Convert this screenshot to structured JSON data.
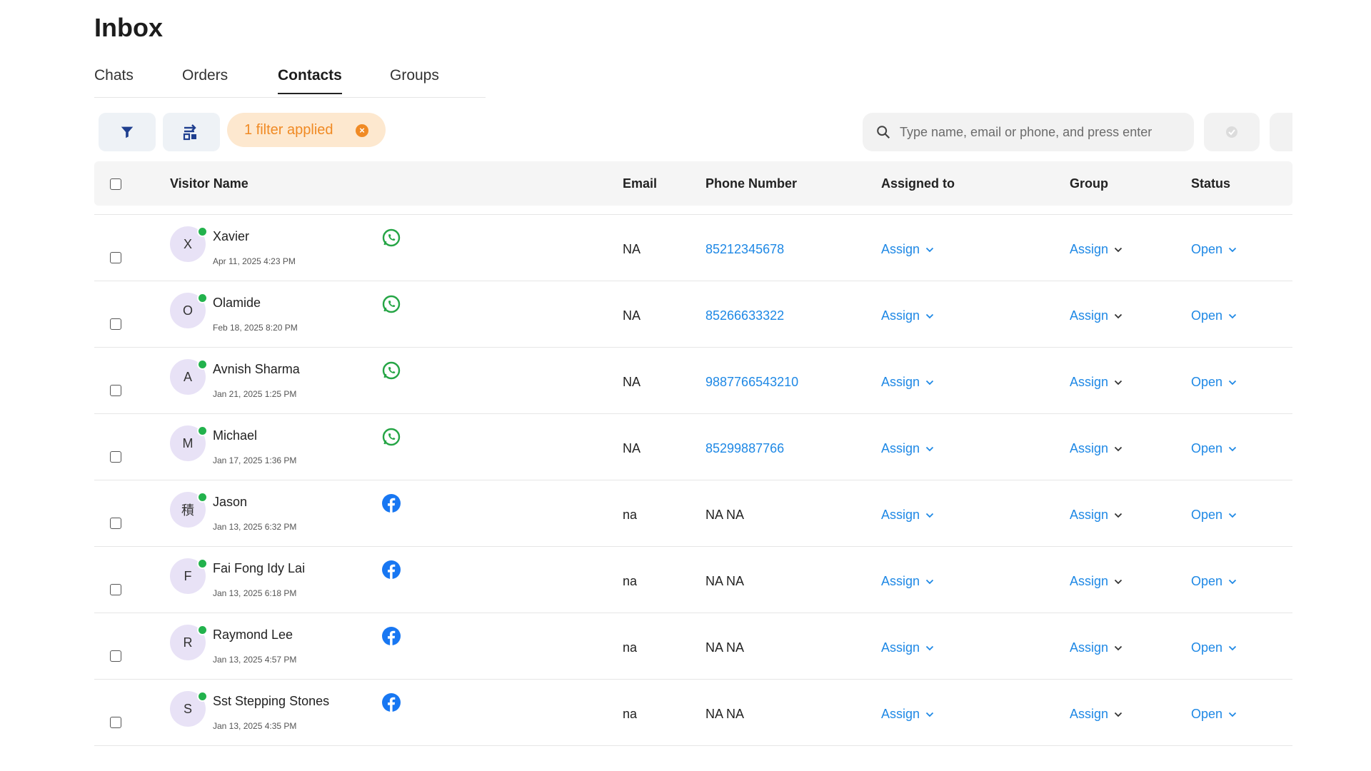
{
  "page_title": "Inbox",
  "tabs": [
    {
      "label": "Chats",
      "active": false
    },
    {
      "label": "Orders",
      "active": false
    },
    {
      "label": "Contacts",
      "active": true
    },
    {
      "label": "Groups",
      "active": false
    }
  ],
  "toolbar": {
    "filter_icon": "filter-icon",
    "sort_icon": "sort-icon",
    "filter_chip_label": "1 filter applied",
    "search_placeholder": "Type name, email or phone, and press enter"
  },
  "colors": {
    "accent_blue": "#1e88e5",
    "chip_orange": "#f08a24",
    "chip_bg": "#fde8cf",
    "online_green": "#22b24c",
    "whatsapp_green": "#25a545",
    "facebook_blue": "#1877f2"
  },
  "table": {
    "headers": {
      "visitor_name": "Visitor Name",
      "email": "Email",
      "phone": "Phone Number",
      "assigned_to": "Assigned to",
      "group": "Group",
      "status": "Status"
    },
    "rows": [
      {
        "initial": "X",
        "name": "Xavier",
        "date": "Apr 11, 2025 4:23 PM",
        "channel": "whatsapp",
        "email": "NA",
        "phone": "85212345678",
        "phone_link": true,
        "assigned": "Assign",
        "group": "Assign",
        "status": "Open"
      },
      {
        "initial": "O",
        "name": "Olamide",
        "date": "Feb 18, 2025 8:20 PM",
        "channel": "whatsapp",
        "email": "NA",
        "phone": "85266633322",
        "phone_link": true,
        "assigned": "Assign",
        "group": "Assign",
        "status": "Open"
      },
      {
        "initial": "A",
        "name": "Avnish Sharma",
        "date": "Jan 21, 2025 1:25 PM",
        "channel": "whatsapp",
        "email": "NA",
        "phone": "9887766543210",
        "phone_link": true,
        "assigned": "Assign",
        "group": "Assign",
        "status": "Open"
      },
      {
        "initial": "M",
        "name": "Michael",
        "date": "Jan 17, 2025 1:36 PM",
        "channel": "whatsapp",
        "email": "NA",
        "phone": "85299887766",
        "phone_link": true,
        "assigned": "Assign",
        "group": "Assign",
        "status": "Open"
      },
      {
        "initial": "積",
        "name": "Jason",
        "date": "Jan 13, 2025 6:32 PM",
        "channel": "facebook",
        "email": "na",
        "phone": "NA NA",
        "phone_link": false,
        "assigned": "Assign",
        "group": "Assign",
        "status": "Open"
      },
      {
        "initial": "F",
        "name": "Fai Fong Idy Lai",
        "date": "Jan 13, 2025 6:18 PM",
        "channel": "facebook",
        "email": "na",
        "phone": "NA NA",
        "phone_link": false,
        "assigned": "Assign",
        "group": "Assign",
        "status": "Open"
      },
      {
        "initial": "R",
        "name": "Raymond Lee",
        "date": "Jan 13, 2025 4:57 PM",
        "channel": "facebook",
        "email": "na",
        "phone": "NA NA",
        "phone_link": false,
        "assigned": "Assign",
        "group": "Assign",
        "status": "Open"
      },
      {
        "initial": "S",
        "name": "Sst Stepping Stones",
        "date": "Jan 13, 2025 4:35 PM",
        "channel": "facebook",
        "email": "na",
        "phone": "NA NA",
        "phone_link": false,
        "assigned": "Assign",
        "group": "Assign",
        "status": "Open"
      }
    ]
  }
}
